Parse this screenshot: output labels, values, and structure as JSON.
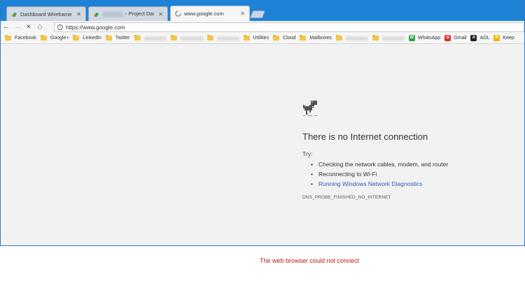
{
  "tabs": [
    {
      "title": "Dashboard Wireframes",
      "icon": "green-brush-icon",
      "active": false
    },
    {
      "title": "- Project Dashb",
      "icon": "green-brush-icon",
      "active": false
    },
    {
      "title": "www.google.com",
      "icon": "loading-spinner-icon",
      "active": true
    }
  ],
  "toolbar": {
    "url": "https://www.google.com",
    "back": "←",
    "forward": "→",
    "stop": "✕",
    "home": "⌂",
    "info": "i"
  },
  "bookmarks": [
    {
      "label": "Facebook",
      "type": "folder"
    },
    {
      "label": "Google+",
      "type": "folder"
    },
    {
      "label": "LinkedIn",
      "type": "folder"
    },
    {
      "label": "Twitter",
      "type": "folder"
    },
    {
      "label": "",
      "type": "blurred"
    },
    {
      "label": "",
      "type": "blurred"
    },
    {
      "label": "",
      "type": "blurred"
    },
    {
      "label": "Utilities",
      "type": "folder"
    },
    {
      "label": "Cloud",
      "type": "folder"
    },
    {
      "label": "Mailboxes",
      "type": "folder"
    },
    {
      "label": "",
      "type": "blurred"
    },
    {
      "label": "",
      "type": "blurred"
    },
    {
      "label": "WhatsApp",
      "type": "icon",
      "icon": "whatsapp-icon",
      "color": "#25a84a"
    },
    {
      "label": "Gmail",
      "type": "icon",
      "icon": "gmail-icon",
      "color": "#d93025"
    },
    {
      "label": "AOL",
      "type": "icon",
      "icon": "aol-icon",
      "color": "#222222"
    },
    {
      "label": "Keep",
      "type": "icon",
      "icon": "keep-icon",
      "color": "#f4b400"
    }
  ],
  "error": {
    "heading": "There is no Internet connection",
    "try": "Try:",
    "suggestions": [
      "Checking the network cables, modem, and router",
      "Reconnecting to Wi-Fi",
      "Running Windows Network Diagnostics"
    ],
    "code": "DNS_PROBE_FINISHED_NO_INTERNET"
  },
  "caption": "The web browser could not connect",
  "colors": {
    "tabstrip": "#1e83d6",
    "link": "#2b5fa5",
    "caption": "#c0151b",
    "content_bg": "#f2f2f2"
  }
}
